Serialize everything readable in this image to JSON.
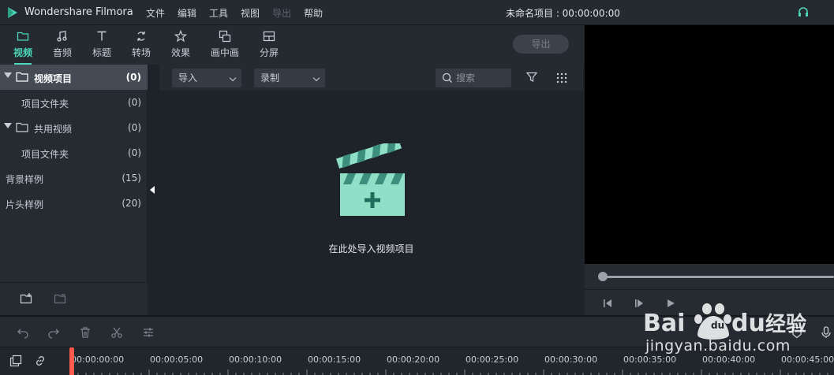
{
  "app": {
    "name": "Wondershare Filmora",
    "project_title": "未命名项目 : 00:00:00:00"
  },
  "menu": [
    "文件",
    "编辑",
    "工具",
    "视图",
    "导出",
    "帮助"
  ],
  "tabs": [
    {
      "label": "视频",
      "icon": "folder-icon",
      "active": true
    },
    {
      "label": "音频",
      "icon": "music-note-icon",
      "active": false
    },
    {
      "label": "标题",
      "icon": "text-icon",
      "active": false
    },
    {
      "label": "转场",
      "icon": "transition-icon",
      "active": false
    },
    {
      "label": "效果",
      "icon": "effects-icon",
      "active": false
    },
    {
      "label": "画中画",
      "icon": "pip-icon",
      "active": false
    },
    {
      "label": "分屏",
      "icon": "split-screen-icon",
      "active": false
    }
  ],
  "export_button": "导出",
  "sidebar": {
    "items": [
      {
        "label": "视频项目",
        "count": "(0)",
        "selected": true,
        "expandable": true
      },
      {
        "label": "项目文件夹",
        "count": "(0)",
        "selected": false,
        "expandable": false
      },
      {
        "label": "共用视频",
        "count": "(0)",
        "selected": false,
        "expandable": true
      },
      {
        "label": "项目文件夹",
        "count": "(0)",
        "selected": false,
        "expandable": false
      },
      {
        "label": "背景样例",
        "count": "(15)",
        "selected": false,
        "expandable": false
      },
      {
        "label": "片头样例",
        "count": "(20)",
        "selected": false,
        "expandable": false
      }
    ]
  },
  "media_toolbar": {
    "import_dropdown": "导入",
    "record_dropdown": "录制",
    "search_placeholder": "搜索"
  },
  "media_empty_text": "在此处导入视频项目",
  "timeline": {
    "ticks": [
      "00:00:00:00",
      "00:00:05:00",
      "00:00:10:00",
      "00:00:15:00",
      "00:00:20:00",
      "00:00:25:00",
      "00:00:30:00",
      "00:00:35:00",
      "00:00:40:00",
      "00:00:45:00"
    ]
  },
  "watermark": {
    "text": "jingyan.baidu.com",
    "brand": "Baidu经验"
  },
  "colors": {
    "accent": "#4dd6b9",
    "playhead": "#ff5a4e",
    "background": "#1e232a"
  }
}
